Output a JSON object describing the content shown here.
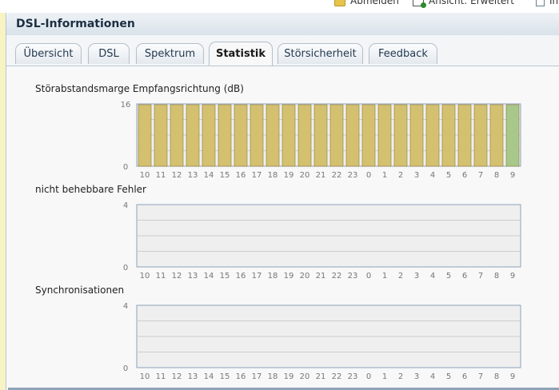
{
  "topbar": {
    "items": [
      {
        "label": "Abmelden",
        "icon": "lock-icon",
        "color": "#e7c44a"
      },
      {
        "label": "Ansicht: Erweitert",
        "icon": "view-icon",
        "color": "#2c8a2c"
      },
      {
        "label": "Inhalt",
        "icon": "content-icon",
        "color": "#6a7f93"
      }
    ]
  },
  "header": {
    "title": "DSL-Informationen"
  },
  "tabs": [
    {
      "label": "Übersicht",
      "active": false
    },
    {
      "label": "DSL",
      "active": false
    },
    {
      "label": "Spektrum",
      "active": false
    },
    {
      "label": "Statistik",
      "active": true
    },
    {
      "label": "Störsicherheit",
      "active": false
    },
    {
      "label": "Feedback",
      "active": false
    }
  ],
  "colors": {
    "bar_fill": "#d4c170",
    "bar_highlight": "#a8c88a",
    "plot_bg": "#efefef",
    "axis_color": "#8ea2b8",
    "grid_color": "#cccccc",
    "label_color": "#777777"
  },
  "chart_data": [
    {
      "type": "bar",
      "title": "Störabstandsmarge Empfangsrichtung (dB)",
      "categories": [
        "10",
        "11",
        "12",
        "13",
        "14",
        "15",
        "16",
        "17",
        "18",
        "19",
        "20",
        "21",
        "22",
        "23",
        "0",
        "1",
        "2",
        "3",
        "4",
        "5",
        "6",
        "7",
        "8",
        "9"
      ],
      "values": [
        16,
        16,
        16,
        16,
        16,
        16,
        16,
        16,
        16,
        16,
        16,
        16,
        16,
        16,
        16,
        16,
        16,
        16,
        16,
        16,
        16,
        16,
        16,
        16
      ],
      "highlight_index": 23,
      "ylim": [
        0,
        16
      ],
      "yticks": [
        "0",
        "16"
      ],
      "grid": true
    },
    {
      "type": "bar",
      "title": "nicht behebbare Fehler",
      "categories": [
        "10",
        "11",
        "12",
        "13",
        "14",
        "15",
        "16",
        "17",
        "18",
        "19",
        "20",
        "21",
        "22",
        "23",
        "0",
        "1",
        "2",
        "3",
        "4",
        "5",
        "6",
        "7",
        "8",
        "9"
      ],
      "values": [
        0,
        0,
        0,
        0,
        0,
        0,
        0,
        0,
        0,
        0,
        0,
        0,
        0,
        0,
        0,
        0,
        0,
        0,
        0,
        0,
        0,
        0,
        0,
        0
      ],
      "ylim": [
        0,
        4
      ],
      "yticks": [
        "0",
        "4"
      ],
      "grid": true
    },
    {
      "type": "bar",
      "title": "Synchronisationen",
      "categories": [
        "10",
        "11",
        "12",
        "13",
        "14",
        "15",
        "16",
        "17",
        "18",
        "19",
        "20",
        "21",
        "22",
        "23",
        "0",
        "1",
        "2",
        "3",
        "4",
        "5",
        "6",
        "7",
        "8",
        "9"
      ],
      "values": [
        0,
        0,
        0,
        0,
        0,
        0,
        0,
        0,
        0,
        0,
        0,
        0,
        0,
        0,
        0,
        0,
        0,
        0,
        0,
        0,
        0,
        0,
        0,
        0
      ],
      "ylim": [
        0,
        4
      ],
      "yticks": [
        "0",
        "4"
      ],
      "grid": true
    }
  ]
}
